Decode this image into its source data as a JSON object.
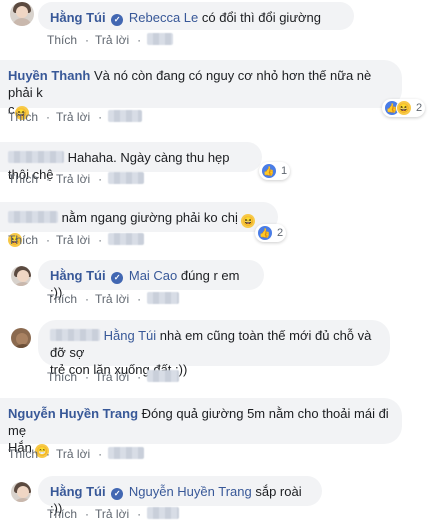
{
  "actions": {
    "like": "Thích",
    "reply": "Trả lời"
  },
  "comments": [
    {
      "author": "Hằng Túi",
      "verified": true,
      "tag": "Rebecca Le",
      "text": "có đổi thì đổi giường"
    },
    {
      "author": "Huyền Thanh",
      "text_line1": "Và nó còn đang có nguy cơ nhỏ hơn thế nữa nè phải k",
      "text_line2": "c",
      "reaction_count": "2"
    },
    {
      "text": "Hahaha. Ngày càng thu hẹp thôi chệ",
      "reaction_count": "1"
    },
    {
      "text": "nằm ngang giường phải ko chị",
      "reaction_count": "2"
    },
    {
      "author": "Hằng Túi",
      "tag": "Mai Cao",
      "text": "đúng r em :))"
    },
    {
      "tag": "Hằng Túi",
      "text_line1": "nhà em cũng toàn thế mới đủ chỗ và đỡ sợ",
      "text_line2": "trẻ con lăn xuống đất :))"
    },
    {
      "author": "Nguyễn Huyền Trang",
      "text_line1": "Đóng quả giường 5m nằm cho thoải mái đi mẹ",
      "text_line2": "Hắn"
    },
    {
      "author": "Hằng Túi",
      "tag": "Nguyễn Huyền Trang",
      "text": "sắp roài :))"
    }
  ],
  "icons": {
    "like": "like-icon",
    "haha": "haha-icon",
    "grin": "grin-emoji",
    "laugh": "laughing-emoji",
    "verified": "verified-badge-icon"
  },
  "colors": {
    "author": "#385898",
    "bubble": "#f2f3f5",
    "meta": "#606770"
  }
}
